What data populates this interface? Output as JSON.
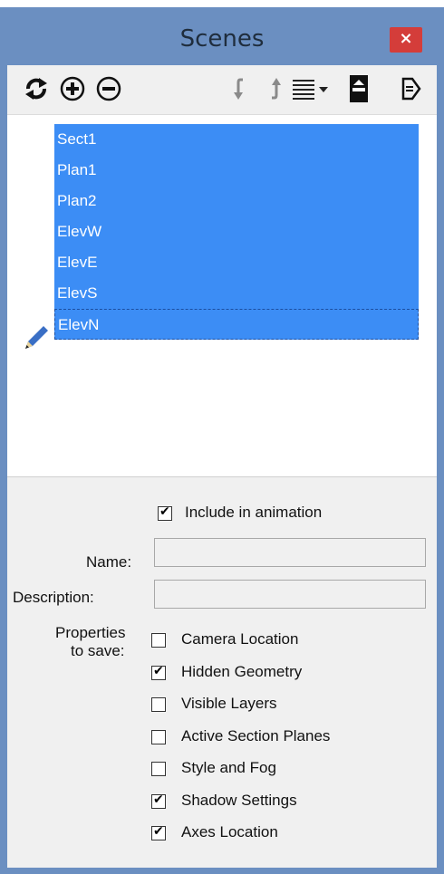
{
  "window": {
    "title": "Scenes",
    "close_glyph": "×"
  },
  "toolbar": {
    "icons": [
      "refresh-icon",
      "add-scene-icon",
      "remove-scene-icon",
      "move-down-icon",
      "move-up-icon",
      "view-options-icon",
      "show-details-icon",
      "expand-icon"
    ]
  },
  "scenes": [
    "Sect1",
    "Plan1",
    "Plan2",
    "ElevW",
    "ElevE",
    "ElevS",
    "ElevN"
  ],
  "details": {
    "include_in_animation": {
      "label": "Include in animation",
      "checked": true
    },
    "name_label": "Name:",
    "name_value": "",
    "description_label": "Description:",
    "description_value": "",
    "properties_label_line1": "Properties",
    "properties_label_line2": "to save:",
    "properties": [
      {
        "label": "Camera Location",
        "checked": false
      },
      {
        "label": "Hidden Geometry",
        "checked": true
      },
      {
        "label": "Visible Layers",
        "checked": false
      },
      {
        "label": "Active Section Planes",
        "checked": false
      },
      {
        "label": "Style and Fog",
        "checked": false
      },
      {
        "label": "Shadow Settings",
        "checked": true
      },
      {
        "label": "Axes Location",
        "checked": true
      }
    ]
  },
  "colors": {
    "selection": "#3c8df5",
    "frame": "#6b8fc1",
    "close": "#d43d3a"
  }
}
